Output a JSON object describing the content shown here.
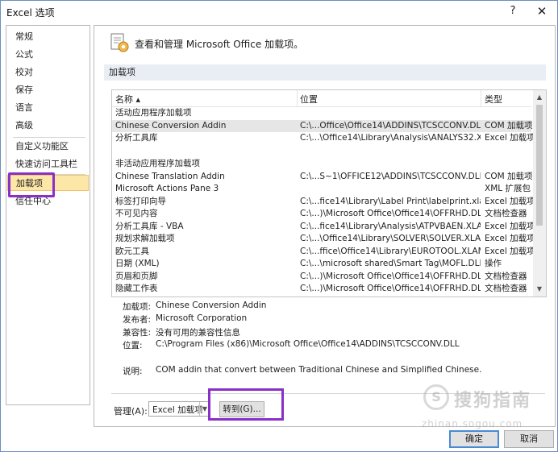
{
  "window": {
    "title": "Excel 选项",
    "help": "?",
    "close": "✕"
  },
  "nav": {
    "items": [
      {
        "label": "常规"
      },
      {
        "label": "公式"
      },
      {
        "label": "校对"
      },
      {
        "label": "保存"
      },
      {
        "label": "语言"
      },
      {
        "label": "高级"
      },
      {
        "label": "自定义功能区"
      },
      {
        "label": "快速访问工具栏"
      },
      {
        "label": "加载项",
        "selected": true
      },
      {
        "label": "信任中心"
      }
    ]
  },
  "header": {
    "title": "查看和管理 Microsoft Office 加载项。",
    "icon": "addin-gear-icon"
  },
  "section": {
    "title": "加载项"
  },
  "list": {
    "columns": {
      "name": "名称 ▴",
      "location": "位置",
      "type": "类型"
    },
    "groups": {
      "active": "活动应用程序加载项",
      "inactive": "非活动应用程序加载项"
    },
    "active_rows": [
      {
        "name": "Chinese Conversion Addin",
        "location": "C:\\...Office\\Office14\\ADDINS\\TCSCCONV.DLL",
        "type": "COM 加载项"
      },
      {
        "name": "分析工具库",
        "location": "C:\\...\\Office14\\Library\\Analysis\\ANALYS32.XLL",
        "type": "Excel 加载项"
      }
    ],
    "inactive_rows": [
      {
        "name": "Chinese Translation Addin",
        "location": "C:\\...S~1\\OFFICE12\\ADDINS\\TCSCCONV.DLL",
        "type": "COM 加载项"
      },
      {
        "name": "Microsoft Actions Pane 3",
        "location": "",
        "type": "XML 扩展包"
      },
      {
        "name": "标签打印向导",
        "location": "C:\\...fice14\\Library\\Label Print\\labelprint.xlam",
        "type": "Excel 加载项"
      },
      {
        "name": "不可见内容",
        "location": "C:\\...)\\Microsoft Office\\Office14\\OFFRHD.DLL",
        "type": "文档检查器"
      },
      {
        "name": "分析工具库 - VBA",
        "location": "C:\\...fice14\\Library\\Analysis\\ATPVBAEN.XLAM",
        "type": "Excel 加载项"
      },
      {
        "name": "规划求解加载项",
        "location": "C:\\...\\Office14\\Library\\SOLVER\\SOLVER.XLAM",
        "type": "Excel 加载项"
      },
      {
        "name": "欧元工具",
        "location": "C:\\...ffice\\Office14\\Library\\EUROTOOL.XLAM",
        "type": "Excel 加载项"
      },
      {
        "name": "日期 (XML)",
        "location": "C:\\...\\microsoft shared\\Smart Tag\\MOFL.DLL",
        "type": "操作"
      },
      {
        "name": "页眉和页脚",
        "location": "C:\\...)\\Microsoft Office\\Office14\\OFFRHD.DLL",
        "type": "文档检查器"
      },
      {
        "name": "隐藏工作表",
        "location": "C:\\...)\\Microsoft Office\\Office14\\OFFRHD.DLL",
        "type": "文档检查器"
      }
    ]
  },
  "details": {
    "addin_label": "加载项:",
    "addin_value": "Chinese Conversion Addin",
    "publisher_label": "发布者:",
    "publisher_value": "Microsoft Corporation",
    "compat_label": "兼容性:",
    "compat_value": "没有可用的兼容性信息",
    "location_label": "位置:",
    "location_value": "C:\\Program Files (x86)\\Microsoft Office\\Office14\\ADDINS\\TCSCCONV.DLL",
    "desc_label": "说明:",
    "desc_value": "COM addin that convert between Traditional Chinese and Simplified Chinese."
  },
  "manage": {
    "label": "管理(A):",
    "selected": "Excel 加载项",
    "goto": "转到(G)..."
  },
  "footer": {
    "ok": "确定",
    "cancel": "取消"
  },
  "watermark": {
    "logo": "S",
    "text": "搜狗指南",
    "sub": "zhinan.sogou.com"
  },
  "colors": {
    "highlight": "#8a2fc7",
    "selected_nav": "#fde7a6",
    "section_bar": "#e9eef5"
  }
}
